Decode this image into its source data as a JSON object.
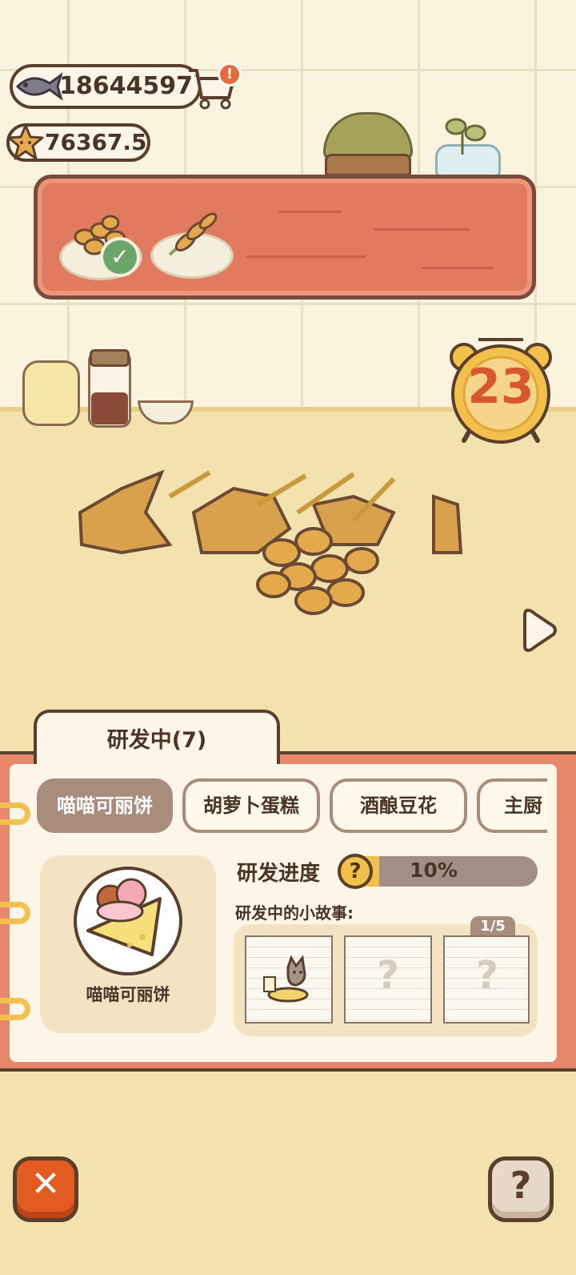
{
  "currency": {
    "fish_value": "18644597",
    "star_value": "76367.5",
    "cart_badge": "!"
  },
  "timer": {
    "value": "23"
  },
  "panel": {
    "tab_label": "研发中(7)",
    "recipes": [
      "喵喵可丽饼",
      "胡萝卜蛋糕",
      "酒酿豆花",
      "主厨"
    ],
    "active_recipe": "喵喵可丽饼",
    "card_label": "喵喵可丽饼",
    "progress_label": "研发进度",
    "progress_help": "?",
    "progress_value": "10%",
    "progress_fraction": 0.1,
    "story_label": "研发中的小故事:",
    "story_page": "1/5",
    "story_locked_mark": "?"
  },
  "buttons": {
    "close_glyph": "✕",
    "help_glyph": "?"
  },
  "colors": {
    "accent_orange": "#e45b22",
    "board_red": "#e17a5e",
    "gold": "#f3c04a",
    "chip_active": "#a98d7c"
  }
}
